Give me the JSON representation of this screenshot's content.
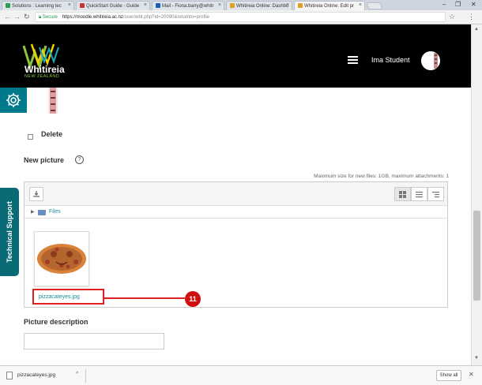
{
  "browser": {
    "tabs": [
      {
        "label": "Solutions : Learning tec"
      },
      {
        "label": "QuickStart Guide - Guide"
      },
      {
        "label": "Mail - Fiona.barry@whitr"
      },
      {
        "label": "Whitireia Online: Dashbo"
      },
      {
        "label": "Whitireia Online: Edit pr"
      }
    ],
    "secure_label": "Secure",
    "url_host": "https://moodle.whitireia.ac.nz",
    "url_path": "/user/edit.php?id=20090&returnto=profile",
    "icons": [
      "back-icon",
      "forward-icon",
      "reload-icon",
      "star-icon",
      "menu-icon"
    ]
  },
  "header": {
    "logo_text": "Whitireia",
    "logo_subtext": "NEW ZEALAND",
    "username": "Ima Student",
    "colors": {
      "background": "#000000",
      "logo_green": "#8cc63f"
    }
  },
  "sidebar": {
    "tech_support_label": "Technical Support",
    "accent": "#007a8a"
  },
  "form": {
    "delete_label": "Delete",
    "new_picture_label": "New picture",
    "help_glyph": "?",
    "max_size_text": "Maximum size for new files: 1GB, maximum attachments: 1",
    "folder_label": "Files",
    "file_name": "pizzacateyes.jpg",
    "picture_description_label": "Picture description",
    "picture_description_value": ""
  },
  "annotation": {
    "number": "11",
    "color": "#e02020"
  },
  "downloads": {
    "file_name": "pizzacateyes.jpg",
    "show_all_label": "Show all"
  }
}
